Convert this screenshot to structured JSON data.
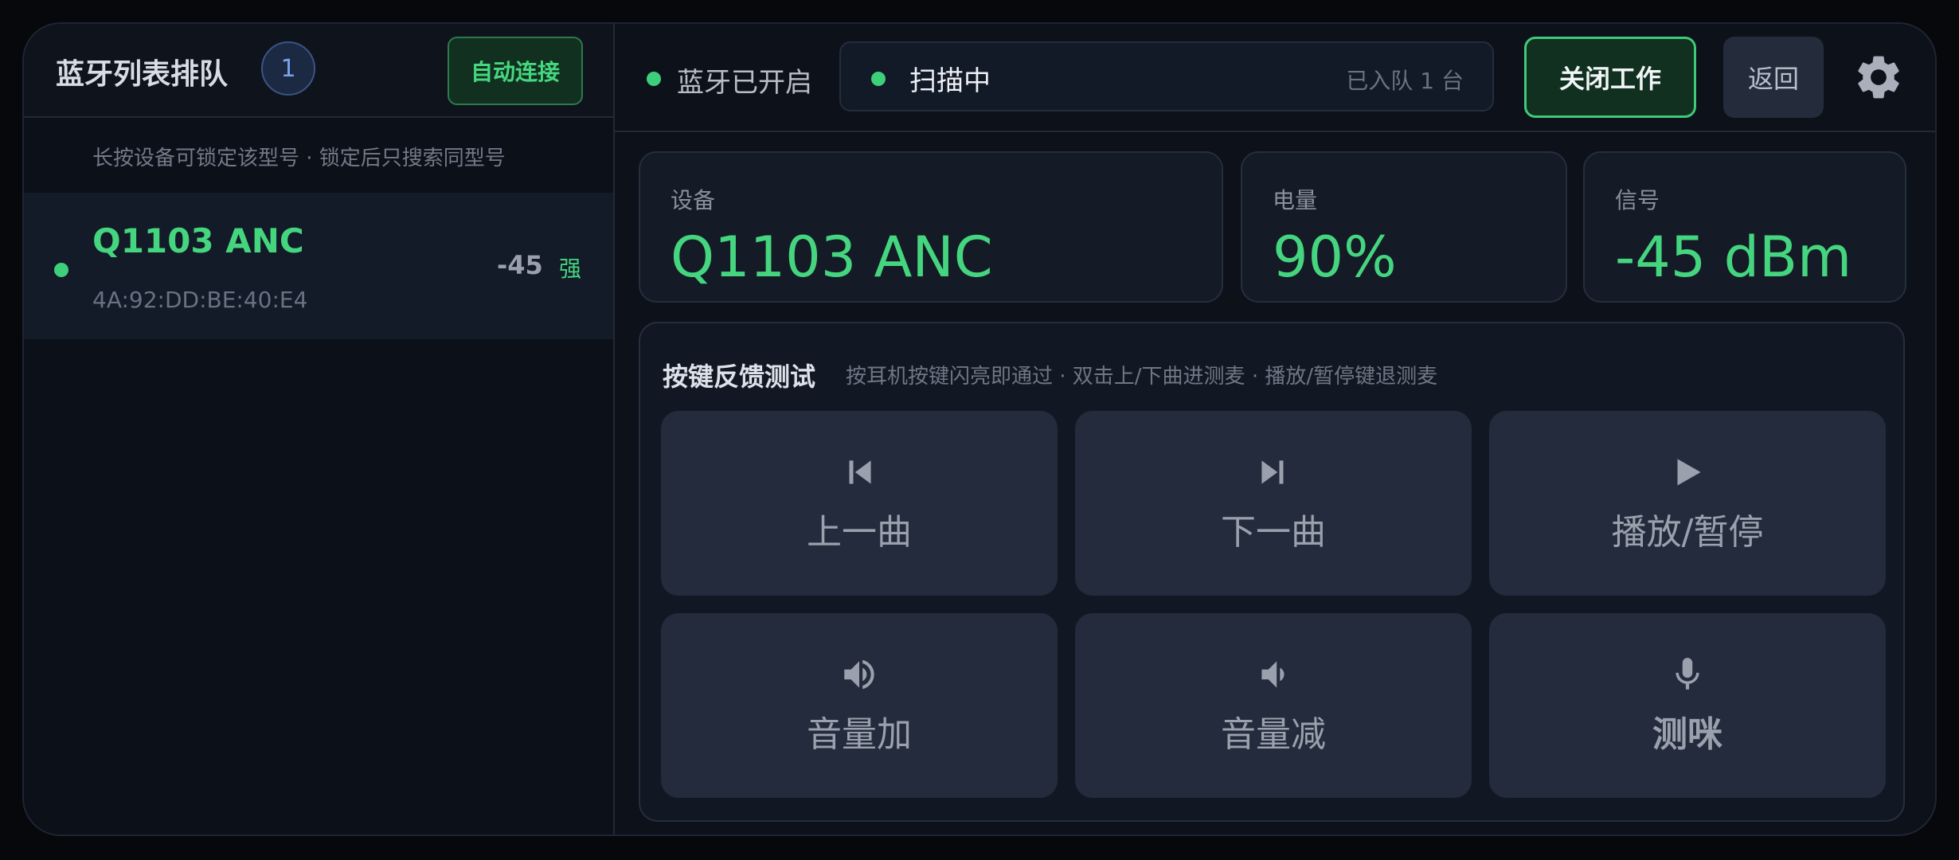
{
  "left_panel": {
    "title": "蓝牙列表排队",
    "count": "1",
    "auto_connect": "自动连接",
    "hint": "长按设备可锁定该型号 · 锁定后只搜索同型号",
    "devices": [
      {
        "name": "Q1103 ANC",
        "mac": "4A:92:DD:BE:40:E4",
        "rssi": "-45",
        "strength": "强"
      }
    ]
  },
  "topbar": {
    "bt_status": "蓝牙已开启",
    "scan_status": "扫描中",
    "queue": "已入队 1 台",
    "close_work": "关闭工作",
    "back": "返回",
    "settings_icon": "gear-icon"
  },
  "stats": {
    "device": {
      "label": "设备",
      "value": "Q1103 ANC"
    },
    "battery": {
      "label": "电量",
      "value": "90%"
    },
    "signal": {
      "label": "信号",
      "value": "-45 dBm"
    }
  },
  "key_test": {
    "title": "按键反馈测试",
    "subtitle": "按耳机按键闪亮即通过 · 双击上/下曲进测麦 · 播放/暂停键退测麦",
    "keys": [
      {
        "label": "上一曲",
        "icon": "skip-previous-icon"
      },
      {
        "label": "下一曲",
        "icon": "skip-next-icon"
      },
      {
        "label": "播放/暂停",
        "icon": "play-icon"
      },
      {
        "label": "音量加",
        "icon": "volume-up-icon"
      },
      {
        "label": "音量减",
        "icon": "volume-down-icon"
      },
      {
        "label": "测咪",
        "icon": "microphone-icon"
      }
    ]
  },
  "colors": {
    "accent_green": "#45d57f",
    "badge_blue": "#7aa2ee",
    "background": "#0d1119",
    "key_bg": "#232b3c"
  }
}
